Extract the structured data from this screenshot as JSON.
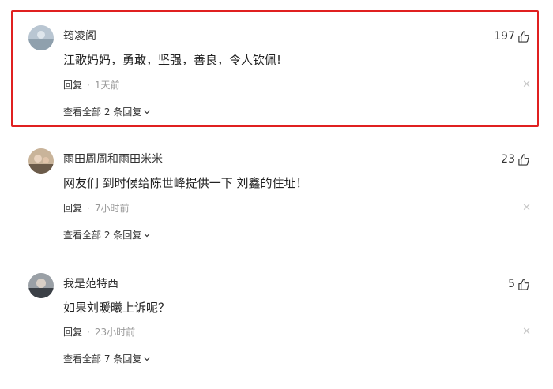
{
  "comments": [
    {
      "username": "筠凌阁",
      "likes": "197",
      "text": "江歌妈妈，勇敢，坚强，善良，令人钦佩!",
      "reply_label": "回复",
      "separator": "·",
      "time": "1天前",
      "view_all": "查看全部 2 条回复",
      "highlighted": true
    },
    {
      "username": "雨田周周和雨田米米",
      "likes": "23",
      "text": "网友们 到时候给陈世峰提供一下 刘鑫的住址！",
      "reply_label": "回复",
      "separator": "·",
      "time": "7小时前",
      "view_all": "查看全部 2 条回复",
      "highlighted": false
    },
    {
      "username": "我是范特西",
      "likes": "5",
      "text": "如果刘暖曦上诉呢？",
      "reply_label": "回复",
      "separator": "·",
      "time": "23小时前",
      "view_all": "查看全部 7 条回复",
      "highlighted": false
    }
  ],
  "colors": {
    "highlight_border": "#e02020",
    "close_icon": "#c8c8c8"
  },
  "icons": {
    "like": "thumbs-up-icon",
    "close": "close-icon",
    "expand": "chevron-down-icon"
  }
}
